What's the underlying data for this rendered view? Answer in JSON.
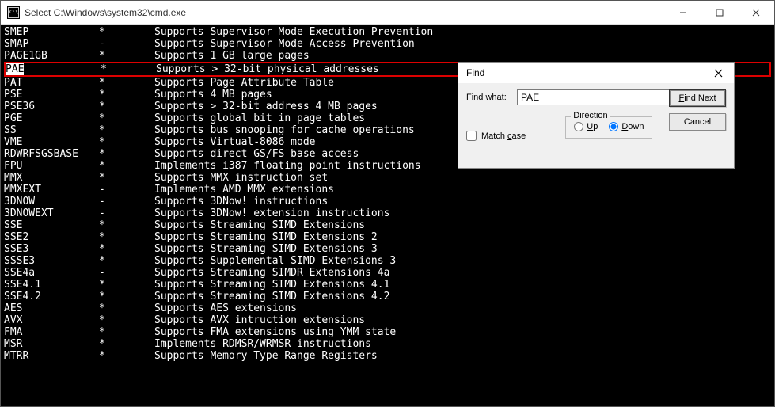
{
  "window": {
    "title": "Select C:\\Windows\\system32\\cmd.exe"
  },
  "highlight_index": 3,
  "selection_text": "PAE",
  "rows": [
    {
      "name": "SMEP",
      "flag": "*",
      "desc": "Supports Supervisor Mode Execution Prevention"
    },
    {
      "name": "SMAP",
      "flag": "-",
      "desc": "Supports Supervisor Mode Access Prevention"
    },
    {
      "name": "PAGE1GB",
      "flag": "*",
      "desc": "Supports 1 GB large pages"
    },
    {
      "name": "PAE",
      "flag": "*",
      "desc": "Supports > 32-bit physical addresses"
    },
    {
      "name": "PAT",
      "flag": "*",
      "desc": "Supports Page Attribute Table"
    },
    {
      "name": "PSE",
      "flag": "*",
      "desc": "Supports 4 MB pages"
    },
    {
      "name": "PSE36",
      "flag": "*",
      "desc": "Supports > 32-bit address 4 MB pages"
    },
    {
      "name": "PGE",
      "flag": "*",
      "desc": "Supports global bit in page tables"
    },
    {
      "name": "SS",
      "flag": "*",
      "desc": "Supports bus snooping for cache operations"
    },
    {
      "name": "VME",
      "flag": "*",
      "desc": "Supports Virtual-8086 mode"
    },
    {
      "name": "RDWRFSGSBASE",
      "flag": "*",
      "desc": "Supports direct GS/FS base access"
    },
    {
      "name": "",
      "flag": "",
      "desc": ""
    },
    {
      "name": "FPU",
      "flag": "*",
      "desc": "Implements i387 floating point instructions"
    },
    {
      "name": "MMX",
      "flag": "*",
      "desc": "Supports MMX instruction set"
    },
    {
      "name": "MMXEXT",
      "flag": "-",
      "desc": "Implements AMD MMX extensions"
    },
    {
      "name": "3DNOW",
      "flag": "-",
      "desc": "Supports 3DNow! instructions"
    },
    {
      "name": "3DNOWEXT",
      "flag": "-",
      "desc": "Supports 3DNow! extension instructions"
    },
    {
      "name": "SSE",
      "flag": "*",
      "desc": "Supports Streaming SIMD Extensions"
    },
    {
      "name": "SSE2",
      "flag": "*",
      "desc": "Supports Streaming SIMD Extensions 2"
    },
    {
      "name": "SSE3",
      "flag": "*",
      "desc": "Supports Streaming SIMD Extensions 3"
    },
    {
      "name": "SSSE3",
      "flag": "*",
      "desc": "Supports Supplemental SIMD Extensions 3"
    },
    {
      "name": "SSE4a",
      "flag": "-",
      "desc": "Supports Streaming SIMDR Extensions 4a"
    },
    {
      "name": "SSE4.1",
      "flag": "*",
      "desc": "Supports Streaming SIMD Extensions 4.1"
    },
    {
      "name": "SSE4.2",
      "flag": "*",
      "desc": "Supports Streaming SIMD Extensions 4.2"
    },
    {
      "name": "",
      "flag": "",
      "desc": ""
    },
    {
      "name": "AES",
      "flag": "*",
      "desc": "Supports AES extensions"
    },
    {
      "name": "AVX",
      "flag": "*",
      "desc": "Supports AVX intruction extensions"
    },
    {
      "name": "FMA",
      "flag": "*",
      "desc": "Supports FMA extensions using YMM state"
    },
    {
      "name": "MSR",
      "flag": "*",
      "desc": "Implements RDMSR/WRMSR instructions"
    },
    {
      "name": "MTRR",
      "flag": "*",
      "desc": "Supports Memory Type Range Registers"
    }
  ],
  "find": {
    "title": "Find",
    "label": "Find what:",
    "value": "PAE",
    "find_next": "Find Next",
    "cancel": "Cancel",
    "direction_label": "Direction",
    "up": "Up",
    "down": "Down",
    "match_case": "Match case",
    "match_case_checked": false,
    "direction_value": "down"
  }
}
